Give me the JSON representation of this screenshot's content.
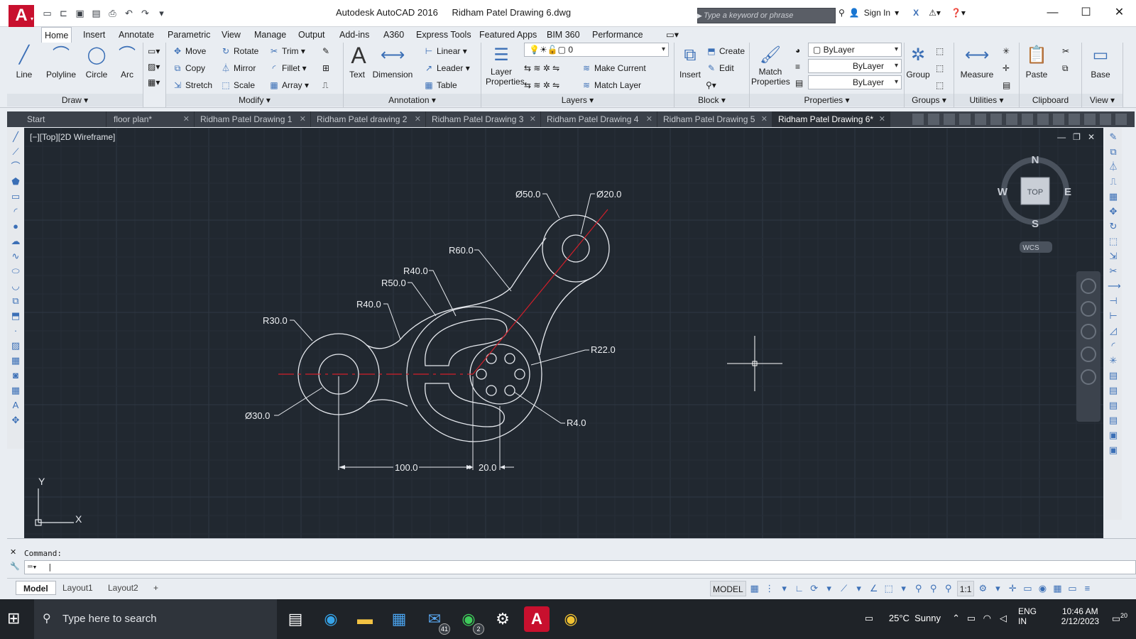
{
  "titlebar": {
    "app_name": "Autodesk AutoCAD 2016",
    "file_name": "Ridham Patel Drawing 6.dwg",
    "search_placeholder": "Type a keyword or phrase",
    "sign_in": "Sign In"
  },
  "menu_tabs": [
    "Home",
    "Insert",
    "Annotate",
    "Parametric",
    "View",
    "Manage",
    "Output",
    "Add-ins",
    "A360",
    "Express Tools",
    "Featured Apps",
    "BIM 360",
    "Performance"
  ],
  "ribbon": {
    "draw": {
      "title": "Draw",
      "line": "Line",
      "polyline": "Polyline",
      "circle": "Circle",
      "arc": "Arc"
    },
    "modify": {
      "title": "Modify",
      "move": "Move",
      "rotate": "Rotate",
      "trim": "Trim",
      "copy": "Copy",
      "mirror": "Mirror",
      "fillet": "Fillet",
      "stretch": "Stretch",
      "scale": "Scale",
      "array": "Array"
    },
    "annotation": {
      "title": "Annotation",
      "text": "Text",
      "dimension": "Dimension",
      "linear": "Linear",
      "leader": "Leader",
      "table": "Table"
    },
    "layers": {
      "title": "Layers",
      "layer_properties_1": "Layer",
      "layer_properties_2": "Properties",
      "current_layer": "0",
      "make_current": "Make Current",
      "match_layer": "Match Layer"
    },
    "block": {
      "title": "Block",
      "insert": "Insert",
      "create": "Create",
      "edit": "Edit"
    },
    "properties": {
      "title": "Properties",
      "match_1": "Match",
      "match_2": "Properties",
      "color": "ByLayer",
      "linetype": "ByLayer",
      "lineweight": "ByLayer"
    },
    "groups": {
      "title": "Groups",
      "group": "Group"
    },
    "utilities": {
      "title": "Utilities",
      "measure": "Measure"
    },
    "clipboard": {
      "title": "Clipboard",
      "paste": "Paste"
    },
    "view": {
      "title": "View",
      "base": "Base"
    }
  },
  "file_tabs": [
    "Start",
    "floor plan*",
    "Ridham Patel Drawing 1",
    "Ridham Patel drawing 2",
    "Ridham Patel Drawing 3",
    "Ridham Patel Drawing 4",
    "Ridham Patel Drawing 5",
    "Ridham Patel Drawing 6*"
  ],
  "viewport": {
    "label": "[−][Top][2D Wireframe]",
    "viewcube": {
      "n": "N",
      "s": "S",
      "e": "E",
      "w": "W",
      "face": "TOP",
      "wcs": "WCS"
    },
    "ucs": {
      "x": "X",
      "y": "Y"
    }
  },
  "dimensions": {
    "d50": "Ø50.0",
    "d20": "Ø20.0",
    "r60": "R60.0",
    "r40a": "R40.0",
    "r50": "R50.0",
    "r40b": "R40.0",
    "r30": "R30.0",
    "r22": "R22.0",
    "d30": "Ø30.0",
    "r4": "R4.0",
    "l100": "100.0",
    "l20": "20.0"
  },
  "command": {
    "history": "Command:",
    "input": ""
  },
  "layout_tabs": [
    "Model",
    "Layout1",
    "Layout2"
  ],
  "status": {
    "model": "MODEL",
    "scale": "1:1"
  },
  "taskbar": {
    "search": "Type here to search",
    "mail_badge": "41",
    "whatsapp_badge": "2",
    "weather": "25°C  Sunny",
    "lang_1": "ENG",
    "lang_2": "IN",
    "time": "10:46 AM",
    "date": "2/12/2023",
    "notifications": "20"
  }
}
